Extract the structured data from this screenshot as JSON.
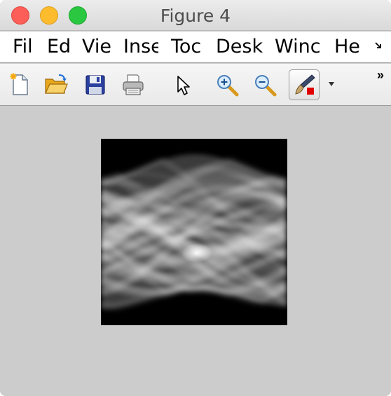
{
  "window": {
    "title": "Figure 4"
  },
  "menubar": {
    "items": [
      "Fil",
      "Ed",
      "Vie",
      "Inse",
      "Toc",
      "Desk",
      "Winc",
      "He"
    ],
    "overflow_icon": "overflow-arrow-icon"
  },
  "toolbar": {
    "tools": [
      {
        "name": "new-figure",
        "icon": "new-document-icon"
      },
      {
        "name": "open-file",
        "icon": "folder-open-icon"
      },
      {
        "name": "save",
        "icon": "floppy-disk-icon"
      },
      {
        "name": "print",
        "icon": "printer-icon"
      },
      {
        "name": "edit-plot",
        "icon": "pointer-arrow-icon"
      },
      {
        "name": "zoom-in",
        "icon": "zoom-in-icon"
      },
      {
        "name": "zoom-out",
        "icon": "zoom-out-icon"
      },
      {
        "name": "brush",
        "icon": "brush-icon",
        "pressed": true
      }
    ],
    "overflow_icon": "double-chevron-icon"
  },
  "figure": {
    "image_description_icon": "sinogram-image",
    "colormap": "gray"
  },
  "colors": {
    "figure_background": "#cccccc",
    "close": "#fc5f57",
    "minimize": "#fdbc2e",
    "zoom": "#29c840"
  }
}
